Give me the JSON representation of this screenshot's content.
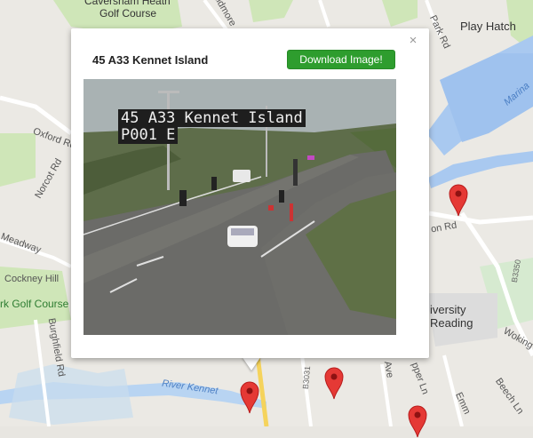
{
  "map": {
    "labels": {
      "caversham_heath": "Caversham Heath",
      "golf_course_top": "Golf Course",
      "play_hatch": "Play Hatch",
      "marina": "Marina",
      "oxford_rd": "Oxford Rd",
      "norcot_rd": "Norcot Rd",
      "meadway": "Meadway",
      "cockney_hill": "Cockney Hill",
      "golf_course_left": "rk Golf Course",
      "burghfield_rd": "Burghfield Rd",
      "river_kennet": "River Kennet",
      "b3031": "B3031",
      "b3350": "B3350",
      "university": "iversity",
      "reading": "Reading",
      "beech_ln": "Beech Ln",
      "wokingham": "Woking",
      "kidmore": "Kidmore",
      "on_rd": "on Rd",
      "pepper_ln": "pper Ln",
      "ave": "Ave",
      "park_rd": "Park Rd",
      "emm": "Emm"
    },
    "marker_color": "#e53935",
    "green_color": "#c8e6b0",
    "water_color": "#a7c8f2"
  },
  "info_window": {
    "title": "45 A33 Kennet Island",
    "download_label": "Download Image!",
    "close_icon": "×",
    "camera": {
      "overlay_line1": "45 A33 Kennet Island",
      "overlay_line2": "P001 E"
    }
  }
}
